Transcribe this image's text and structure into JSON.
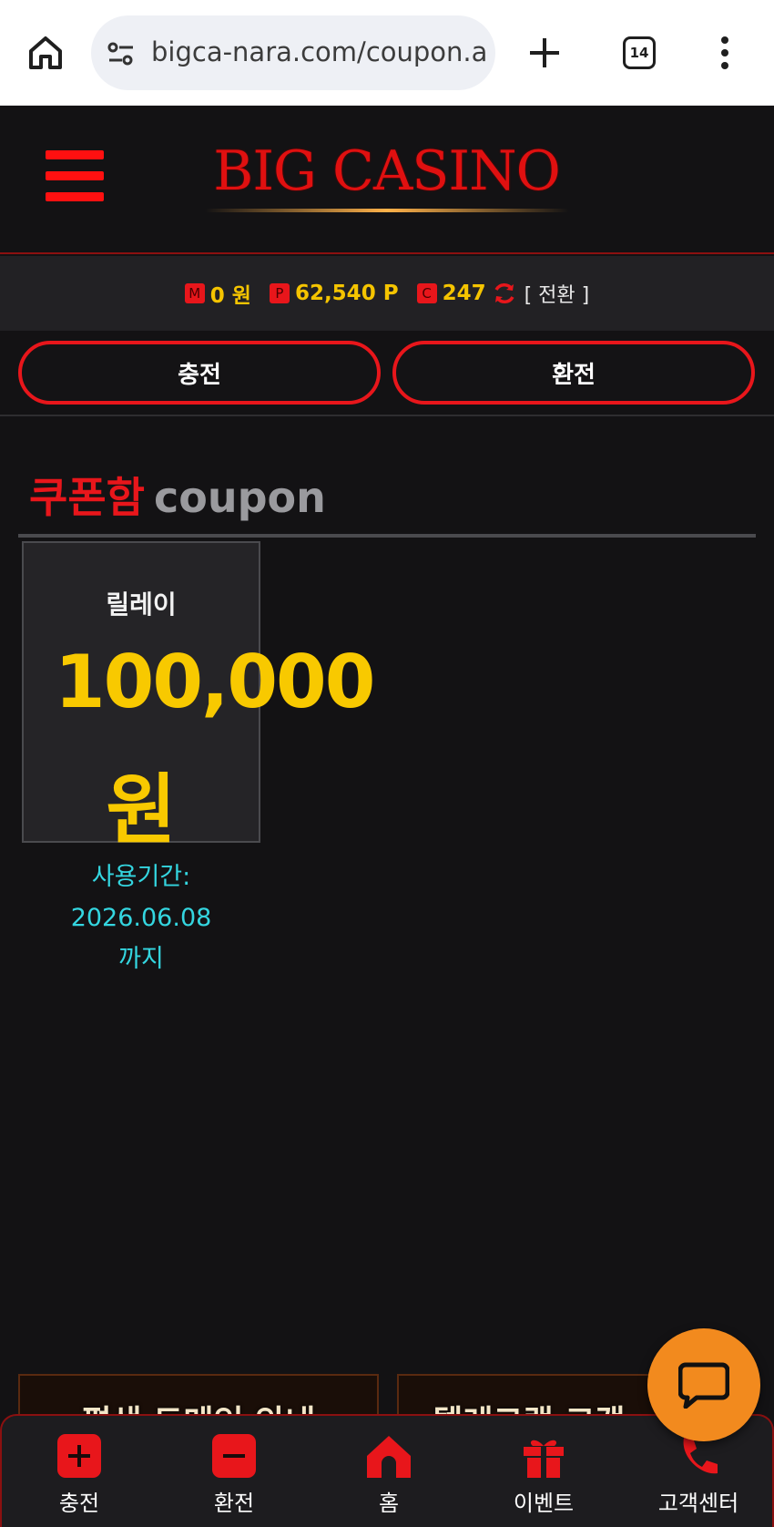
{
  "browser": {
    "url": "bigca-nara.com/coupon.as",
    "tab_count": "14"
  },
  "header": {
    "logo": "BIG CASINO"
  },
  "balance": {
    "money_tag": "M",
    "money_value": "0 원",
    "point_tag": "P",
    "point_value": "62,540 P",
    "comp_tag": "C",
    "comp_value": "247",
    "convert_label": "[ 전환 ]"
  },
  "actions": {
    "charge_label": "충전",
    "exchange_label": "환전"
  },
  "coupon_box": {
    "title_kr": "쿠폰함",
    "title_en": "coupon",
    "coupons": [
      {
        "name": "릴레이",
        "amount": "100,000",
        "unit": "원",
        "period_label": "사용기간:",
        "period_date": "2026.06.08",
        "period_suffix": "까지"
      }
    ]
  },
  "banners": [
    {
      "text": "평생 도메인 안내"
    },
    {
      "text": "텔레그램 고객"
    }
  ],
  "bottom_nav": [
    {
      "label": "충전",
      "icon": "plus-box-icon"
    },
    {
      "label": "환전",
      "icon": "minus-box-icon"
    },
    {
      "label": "홈",
      "icon": "home-icon"
    },
    {
      "label": "이벤트",
      "icon": "gift-icon"
    },
    {
      "label": "고객센터",
      "icon": "phone-icon"
    }
  ],
  "colors": {
    "accent_red": "#e8161b",
    "gold": "#f8c900",
    "cyan": "#34d6e0",
    "background": "#131214",
    "chat_orange": "#f28a1e"
  }
}
